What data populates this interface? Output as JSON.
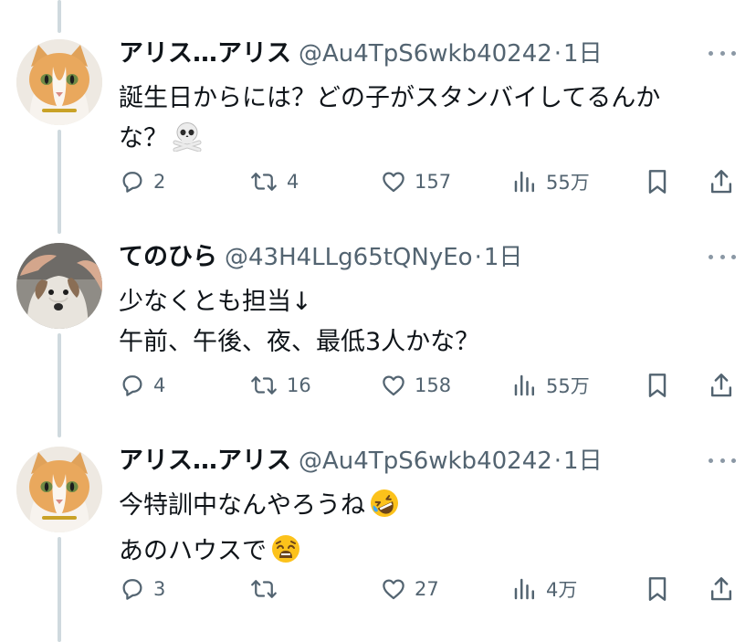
{
  "colors": {
    "text": "#0f1419",
    "secondary": "#536471",
    "thread_line": "#cfd9de"
  },
  "tweets": [
    {
      "avatar_icon": "cat-avatar",
      "name": "アリス…アリス",
      "handle": "@Au4TpS6wkb40242",
      "sep": "·",
      "time": "1日",
      "lines": [
        "誕生日からには？どの子がスタンバイしてるんか",
        "な？"
      ],
      "emoji_icon": "skull-crossbones-icon",
      "replies": "2",
      "retweets": "4",
      "likes": "157",
      "views": "55万"
    },
    {
      "avatar_icon": "dog-avatar",
      "name": "てのひら",
      "handle": "@43H4LLg65tQNyEo",
      "sep": "·",
      "time": "1日",
      "lines": [
        "少なくとも担当↓",
        "午前、午後、夜、最低3人かな？"
      ],
      "replies": "4",
      "retweets": "16",
      "likes": "158",
      "views": "55万"
    },
    {
      "avatar_icon": "cat-avatar",
      "name": "アリス…アリス",
      "handle": "@Au4TpS6wkb40242",
      "sep": "·",
      "time": "1日",
      "lines": [
        "今特訓中なんやろうね",
        "あのハウスで"
      ],
      "emoji_icons": [
        "rolling-laughing-icon",
        "weary-face-icon"
      ],
      "replies": "3",
      "retweets": "",
      "likes": "27",
      "views": "4万"
    }
  ]
}
